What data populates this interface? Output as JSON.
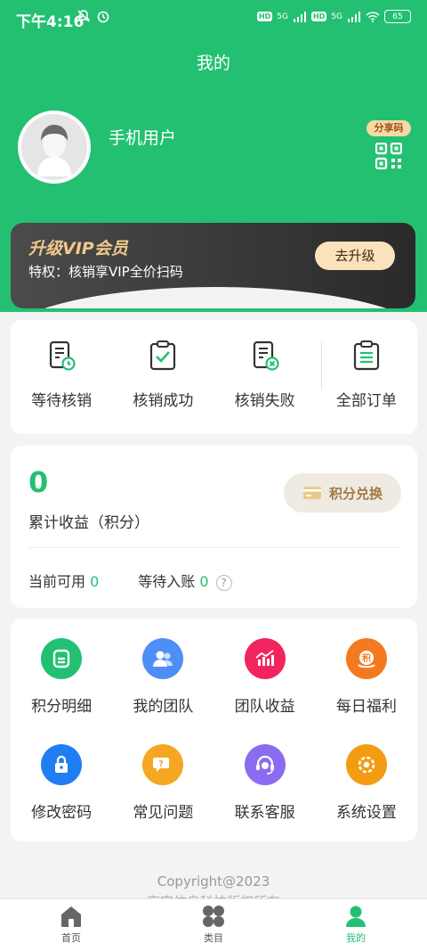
{
  "status": {
    "time": "下午4:16",
    "battery": "65",
    "net1": "5G",
    "net2": "5G",
    "hd": "HD"
  },
  "header": {
    "title": "我的"
  },
  "profile": {
    "username": "手机用户",
    "share_label": "分享码"
  },
  "vip": {
    "title": "升级VIP会员",
    "desc": "特权：核销享VIP全价扫码",
    "button": "去升级"
  },
  "orders": [
    {
      "label": "等待核销",
      "icon": "pending-verify-icon"
    },
    {
      "label": "核销成功",
      "icon": "verify-success-icon"
    },
    {
      "label": "核销失败",
      "icon": "verify-failed-icon"
    },
    {
      "label": "全部订单",
      "icon": "all-orders-icon"
    }
  ],
  "points": {
    "total": "0",
    "total_label": "累计收益（积分）",
    "exchange_label": "积分兑换",
    "available_label": "当前可用",
    "available_value": "0",
    "pending_label": "等待入账",
    "pending_value": "0",
    "help": "?"
  },
  "menu": [
    {
      "label": "积分明细",
      "icon": "points-detail-icon",
      "color": "#23c072"
    },
    {
      "label": "我的团队",
      "icon": "team-icon",
      "color": "#4e8ef7"
    },
    {
      "label": "团队收益",
      "icon": "team-income-icon",
      "color": "#f2245e"
    },
    {
      "label": "每日福利",
      "icon": "daily-bonus-icon",
      "color": "#f47a1f"
    },
    {
      "label": "修改密码",
      "icon": "lock-icon",
      "color": "#1f7ef2"
    },
    {
      "label": "常见问题",
      "icon": "faq-icon",
      "color": "#f5a623"
    },
    {
      "label": "联系客服",
      "icon": "customer-service-icon",
      "color": "#8b6cf0"
    },
    {
      "label": "系统设置",
      "icon": "settings-icon",
      "color": "#f39c12"
    }
  ],
  "footer": {
    "copyright": "Copyright@2023",
    "company": "亨字信息科技版权所有"
  },
  "tabs": [
    {
      "label": "首页",
      "icon": "home-icon"
    },
    {
      "label": "类目",
      "icon": "category-icon"
    },
    {
      "label": "我的",
      "icon": "user-icon",
      "active": true
    }
  ],
  "colors": {
    "brand": "#23c072",
    "vip_gold": "#f2c98a"
  }
}
